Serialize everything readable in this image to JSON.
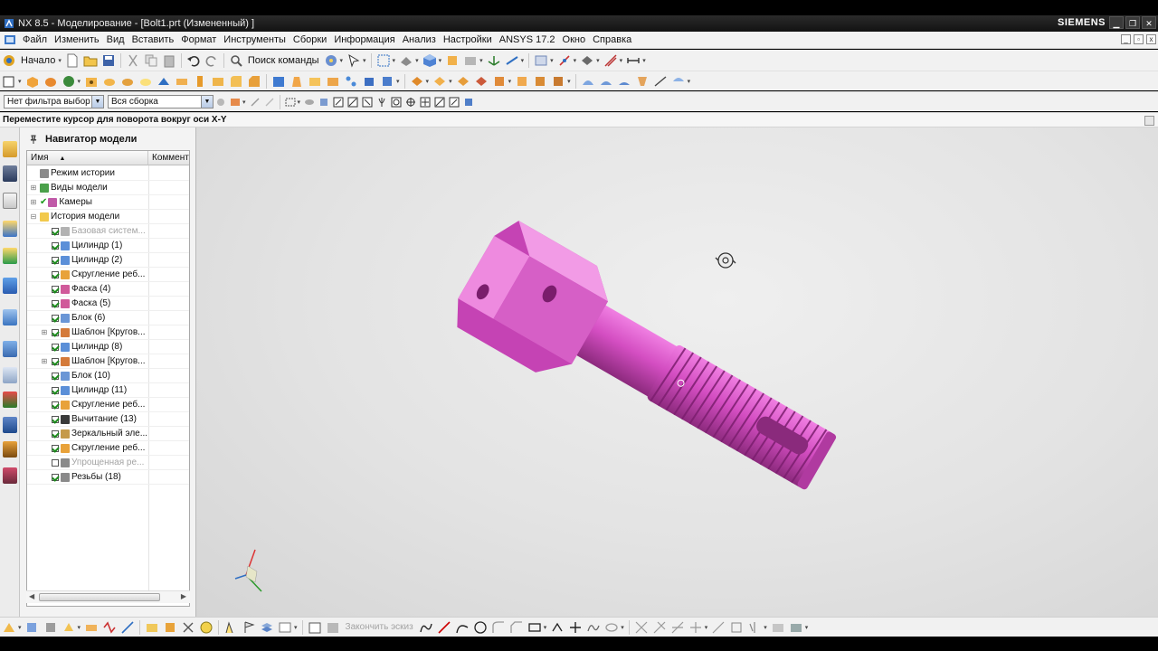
{
  "window": {
    "title": "NX 8.5 - Моделирование - [Bolt1.prt (Измененный) ]",
    "brand": "SIEMENS",
    "controls": [
      "minimize",
      "restore",
      "close"
    ]
  },
  "menu": {
    "items": [
      "Файл",
      "Изменить",
      "Вид",
      "Вставить",
      "Формат",
      "Инструменты",
      "Сборки",
      "Информация",
      "Анализ",
      "Настройки",
      "ANSYS 17.2",
      "Окно",
      "Справка"
    ]
  },
  "toolbar": {
    "start_label": "Начало",
    "command_search_label": "Поиск команды"
  },
  "selection_bar": {
    "type_filter": "Нет фильтра выбор",
    "scope": "Вся сборка"
  },
  "cue_line": "Переместите курсор для поворота вокруг оси X-Y",
  "navigator": {
    "title": "Навигатор модели",
    "columns": [
      "Имя",
      "Коммент"
    ],
    "rows": [
      {
        "label": "Режим истории",
        "level": 0,
        "expander": "",
        "checkbox": "none",
        "icon": "history-mode-icon",
        "dim": false
      },
      {
        "label": "Виды модели",
        "level": 0,
        "expander": "+",
        "checkbox": "none",
        "icon": "model-views-icon",
        "dim": false
      },
      {
        "label": "Камеры",
        "level": 0,
        "expander": "+",
        "checkbox": "check",
        "icon": "cameras-icon",
        "dim": false
      },
      {
        "label": "История модели",
        "level": 0,
        "expander": "-",
        "checkbox": "none",
        "icon": "folder-icon",
        "dim": false
      },
      {
        "label": "Базовая систем...",
        "level": 1,
        "expander": "",
        "checkbox": "on",
        "icon": "datum-csys-icon",
        "dim": true
      },
      {
        "label": "Цилиндр (1)",
        "level": 1,
        "expander": "",
        "checkbox": "on",
        "icon": "cylinder-icon",
        "dim": false
      },
      {
        "label": "Цилиндр (2)",
        "level": 1,
        "expander": "",
        "checkbox": "on",
        "icon": "cylinder-icon",
        "dim": false
      },
      {
        "label": "Скругление реб...",
        "level": 1,
        "expander": "",
        "checkbox": "on",
        "icon": "edge-blend-icon",
        "dim": false
      },
      {
        "label": "Фаска (4)",
        "level": 1,
        "expander": "",
        "checkbox": "on",
        "icon": "chamfer-icon",
        "dim": false
      },
      {
        "label": "Фаска (5)",
        "level": 1,
        "expander": "",
        "checkbox": "on",
        "icon": "chamfer-icon",
        "dim": false
      },
      {
        "label": "Блок (6)",
        "level": 1,
        "expander": "",
        "checkbox": "on",
        "icon": "block-icon",
        "dim": false
      },
      {
        "label": "Шаблон [Кругов...",
        "level": 1,
        "expander": "+",
        "checkbox": "on",
        "icon": "pattern-icon",
        "dim": false
      },
      {
        "label": "Цилиндр (8)",
        "level": 1,
        "expander": "",
        "checkbox": "on",
        "icon": "cylinder-icon",
        "dim": false
      },
      {
        "label": "Шаблон [Кругов...",
        "level": 1,
        "expander": "+",
        "checkbox": "on",
        "icon": "pattern-icon",
        "dim": false
      },
      {
        "label": "Блок (10)",
        "level": 1,
        "expander": "",
        "checkbox": "on",
        "icon": "block-icon",
        "dim": false
      },
      {
        "label": "Цилиндр (11)",
        "level": 1,
        "expander": "",
        "checkbox": "on",
        "icon": "cylinder-icon",
        "dim": false
      },
      {
        "label": "Скругление реб...",
        "level": 1,
        "expander": "",
        "checkbox": "on",
        "icon": "edge-blend-icon",
        "dim": false
      },
      {
        "label": "Вычитание (13)",
        "level": 1,
        "expander": "",
        "checkbox": "on",
        "icon": "subtract-icon",
        "dim": false
      },
      {
        "label": "Зеркальный эле...",
        "level": 1,
        "expander": "",
        "checkbox": "on",
        "icon": "mirror-feature-icon",
        "dim": false
      },
      {
        "label": "Скругление реб...",
        "level": 1,
        "expander": "",
        "checkbox": "on",
        "icon": "edge-blend-icon",
        "dim": false
      },
      {
        "label": "Упрощенная ре...",
        "level": 1,
        "expander": "",
        "checkbox": "off",
        "icon": "thread-icon",
        "dim": true
      },
      {
        "label": "Резьбы (18)",
        "level": 1,
        "expander": "",
        "checkbox": "on",
        "icon": "thread-icon",
        "dim": false
      }
    ]
  },
  "bottom_toolbar": {
    "finish_sketch_label": "Закончить эскиз"
  },
  "colors": {
    "model": "#d44ec2",
    "viewport_bg": "#e4e4e4",
    "titlebar": "#1c1c1c"
  }
}
